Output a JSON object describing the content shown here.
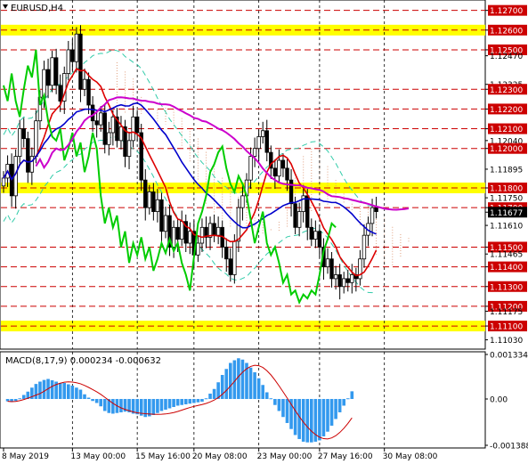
{
  "window": {
    "symbol_label": "EURUSD,H4",
    "macd_label": "MACD(8,17,9) 0.000234 -0.000632"
  },
  "price_axis": {
    "labels": [
      {
        "text": "1.12700",
        "value": 1.127,
        "boxed": true
      },
      {
        "text": "1.12600",
        "value": 1.126,
        "boxed": true
      },
      {
        "text": "1.12500",
        "value": 1.125,
        "boxed": true
      },
      {
        "text": "1.12470",
        "value": 1.1247,
        "boxed": false
      },
      {
        "text": "1.12325",
        "value": 1.12325,
        "boxed": false
      },
      {
        "text": "1.12300",
        "value": 1.123,
        "boxed": true
      },
      {
        "text": "1.12200",
        "value": 1.122,
        "boxed": true
      },
      {
        "text": "1.12100",
        "value": 1.121,
        "boxed": true
      },
      {
        "text": "1.12040",
        "value": 1.1204,
        "boxed": false
      },
      {
        "text": "1.12000",
        "value": 1.12,
        "boxed": true
      },
      {
        "text": "1.11895",
        "value": 1.11895,
        "boxed": false
      },
      {
        "text": "1.11800",
        "value": 1.118,
        "boxed": true
      },
      {
        "text": "1.11750",
        "value": 1.1175,
        "boxed": false
      },
      {
        "text": "1.11700",
        "value": 1.117,
        "boxed": true
      },
      {
        "text": "1.11677",
        "value": 1.11677,
        "boxed": false
      },
      {
        "text": "1.11610",
        "value": 1.1161,
        "boxed": false
      },
      {
        "text": "1.11500",
        "value": 1.115,
        "boxed": true
      },
      {
        "text": "1.11465",
        "value": 1.11465,
        "boxed": false
      },
      {
        "text": "1.11400",
        "value": 1.114,
        "boxed": true
      },
      {
        "text": "1.11300",
        "value": 1.113,
        "boxed": true
      },
      {
        "text": "1.11200",
        "value": 1.112,
        "boxed": true
      },
      {
        "text": "1.11175",
        "value": 1.11175,
        "boxed": false
      },
      {
        "text": "1.11100",
        "value": 1.111,
        "boxed": true
      },
      {
        "text": "1.11030",
        "value": 1.1103,
        "boxed": false
      }
    ]
  },
  "macd_axis": {
    "labels": [
      {
        "text": "0.001334",
        "value": 0.001334
      },
      {
        "text": "0.00",
        "value": 0
      },
      {
        "text": "-0.001388",
        "value": -0.001388
      }
    ]
  },
  "time_axis": {
    "labels": [
      {
        "text": "8 May 2019",
        "bar": 0
      },
      {
        "text": "13 May 00:00",
        "bar": 17
      },
      {
        "text": "15 May 16:00",
        "bar": 33
      },
      {
        "text": "20 May 08:00",
        "bar": 47
      },
      {
        "text": "23 May 00:00",
        "bar": 63
      },
      {
        "text": "27 May 16:00",
        "bar": 78
      },
      {
        "text": "30 May 08:00",
        "bar": 94
      }
    ]
  },
  "colors": {
    "level_line": "#cc0000",
    "yellow_zone": "#ffff00",
    "bull_candle": "#ffffff",
    "bear_candle": "#000000",
    "kijun": "#0000cc",
    "tenkan": "#dd0000",
    "chikou": "#00cc00",
    "cloud_hatch": "#e0a080",
    "magenta_line": "#cc00cc",
    "macd_hist": "#3399ee",
    "macd_signal": "#cc0000",
    "envelope": "#33ccaa",
    "current_price_box": "#000000"
  },
  "chart_data": {
    "type": "candlestick",
    "symbol": "EURUSD",
    "timeframe": "H4",
    "ylim": [
      1.1101,
      1.1273
    ],
    "levels": [
      1.127,
      1.126,
      1.125,
      1.123,
      1.122,
      1.121,
      1.12,
      1.118,
      1.117,
      1.115,
      1.114,
      1.113,
      1.112,
      1.111
    ],
    "yellow_zones": [
      [
        1.12595,
        1.12605
      ],
      [
        1.11795,
        1.11805
      ],
      [
        1.11095,
        1.11105
      ]
    ],
    "current_price": 1.11677,
    "close_series": [
      1.1185,
      1.1192,
      1.1176,
      1.1196,
      1.121,
      1.1205,
      1.1188,
      1.1196,
      1.1214,
      1.1226,
      1.124,
      1.1232,
      1.1246,
      1.1232,
      1.1224,
      1.1238,
      1.125,
      1.1244,
      1.1258,
      1.123,
      1.1235,
      1.1222,
      1.1214,
      1.1212,
      1.1218,
      1.1202,
      1.1208,
      1.1216,
      1.1204,
      1.1211,
      1.1196,
      1.1204,
      1.1216,
      1.1208,
      1.1184,
      1.117,
      1.1178,
      1.1168,
      1.1174,
      1.1158,
      1.1166,
      1.115,
      1.116,
      1.1154,
      1.1163,
      1.1152,
      1.1158,
      1.1146,
      1.1152,
      1.116,
      1.1155,
      1.1162,
      1.1156,
      1.116,
      1.115,
      1.1144,
      1.1136,
      1.1153,
      1.117,
      1.1176,
      1.1184,
      1.1196,
      1.12,
      1.1206,
      1.1209,
      1.1198,
      1.119,
      1.1186,
      1.1194,
      1.119,
      1.1184,
      1.1172,
      1.116,
      1.1168,
      1.1176,
      1.116,
      1.1154,
      1.1158,
      1.115,
      1.114,
      1.1144,
      1.1134,
      1.1136,
      1.113,
      1.1134,
      1.1132,
      1.1136,
      1.1134,
      1.1144,
      1.1156,
      1.1162,
      1.117,
      1.1168
    ],
    "macd_hist": [
      -7e-05,
      -9e-05,
      -6e-05,
      2e-05,
      0.00012,
      0.00022,
      0.00034,
      0.00045,
      0.00052,
      0.00057,
      0.0006,
      0.00056,
      0.00052,
      0.00048,
      0.00048,
      0.00044,
      0.0004,
      0.00034,
      0.00028,
      0.00014,
      4e-05,
      -6e-05,
      -0.00012,
      -0.00022,
      -0.00036,
      -0.00042,
      -0.00044,
      -0.00042,
      -0.0004,
      -0.00038,
      -0.0004,
      -0.00044,
      -0.00046,
      -0.0005,
      -0.00054,
      -0.00052,
      -0.00048,
      -0.00042,
      -0.00036,
      -0.00032,
      -0.00028,
      -0.00024,
      -0.0002,
      -0.00018,
      -0.00016,
      -0.00014,
      -0.00012,
      -0.0001,
      -8e-05,
      2e-05,
      0.00016,
      0.0003,
      0.0005,
      0.00072,
      0.0009,
      0.00108,
      0.00116,
      0.00122,
      0.00118,
      0.00108,
      0.00094,
      0.0008,
      0.00062,
      0.00042,
      0.0002,
      2e-05,
      -0.00018,
      -0.00036,
      -0.00054,
      -0.00072,
      -0.0009,
      -0.00108,
      -0.0012,
      -0.00128,
      -0.0013,
      -0.0013,
      -0.00128,
      -0.00124,
      -0.00112,
      -0.00098,
      -0.0008,
      -0.0006,
      -0.0004,
      -0.0002,
      2e-05,
      0.00023
    ],
    "macd_ylim": [
      -0.001388,
      0.001334
    ]
  }
}
